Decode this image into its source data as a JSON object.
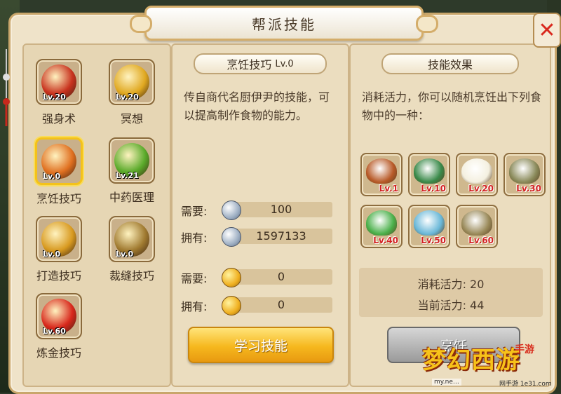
{
  "title": "帮派技能",
  "skills": [
    {
      "name": "强身术",
      "level": "Lv.20",
      "color": "#c8321e"
    },
    {
      "name": "冥想",
      "level": "Lv.20",
      "color": "#e0a820"
    },
    {
      "name": "烹饪技巧",
      "level": "Lv.0",
      "color": "#e07020",
      "selected": true
    },
    {
      "name": "中药医理",
      "level": "Lv.21",
      "color": "#5aaa2a"
    },
    {
      "name": "打造技巧",
      "level": "Lv.0",
      "color": "#d89a20"
    },
    {
      "name": "裁缝技巧",
      "level": "Lv.0",
      "color": "#a07a30"
    },
    {
      "name": "炼金技巧",
      "level": "Lv.60",
      "color": "#d8281c"
    }
  ],
  "detail": {
    "title": "烹饪技巧",
    "title_level": "Lv.0",
    "description": "传自商代名厨伊尹的技能，可以提高制作食物的能力。",
    "need_silver_label": "需要:",
    "need_silver": "100",
    "have_silver_label": "拥有:",
    "have_silver": "1597133",
    "need_gold_label": "需要:",
    "need_gold": "0",
    "have_gold_label": "拥有:",
    "have_gold": "0",
    "learn_button": "学习技能"
  },
  "effect": {
    "title": "技能效果",
    "description": "消耗活力，你可以随机烹饪出下列食物中的一种：",
    "foods": [
      {
        "level": "Lv.1",
        "color": "#b85a28"
      },
      {
        "level": "Lv.10",
        "color": "#3a8a4a"
      },
      {
        "level": "Lv.20",
        "color": "#f4f0e0"
      },
      {
        "level": "Lv.30",
        "color": "#8a8a5a"
      },
      {
        "level": "Lv.40",
        "color": "#4ab04a"
      },
      {
        "level": "Lv.50",
        "color": "#6ab8d8"
      },
      {
        "level": "Lv.60",
        "color": "#9a8a5a"
      }
    ],
    "cost_label": "消耗活力: 20",
    "current_label": "当前活力: 44",
    "cook_button": "烹饪"
  },
  "watermark": {
    "logo": "梦幻西游",
    "side": "手游",
    "url": "my.ne…",
    "url2": "网手游 1e31.com"
  }
}
